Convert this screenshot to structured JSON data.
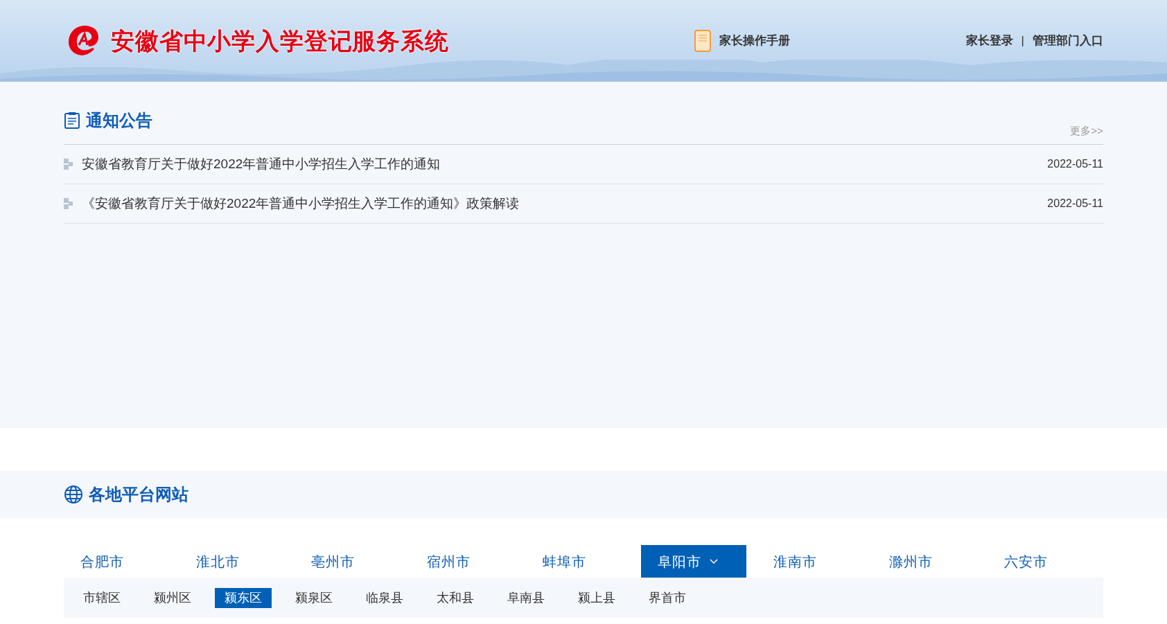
{
  "header": {
    "title": "安徽省中小学入学登记服务系统",
    "manual_link": "家长操作手册",
    "nav": [
      "家长登录",
      "管理部门入口"
    ],
    "separator": "|"
  },
  "notices": {
    "title": "通知公告",
    "more": "更多>>",
    "items": [
      {
        "title": "安徽省教育厅关于做好2022年普通中小学招生入学工作的通知",
        "date": "2022-05-11"
      },
      {
        "title": "《安徽省教育厅关于做好2022年普通中小学招生入学工作的通知》政策解读",
        "date": "2022-05-11"
      }
    ]
  },
  "regions": {
    "title": "各地平台网站",
    "cities": [
      {
        "label": "合肥市",
        "selected": false
      },
      {
        "label": "淮北市",
        "selected": false
      },
      {
        "label": "亳州市",
        "selected": false
      },
      {
        "label": "宿州市",
        "selected": false
      },
      {
        "label": "蚌埠市",
        "selected": false
      },
      {
        "label": "阜阳市",
        "selected": true
      },
      {
        "label": "淮南市",
        "selected": false
      },
      {
        "label": "滁州市",
        "selected": false
      },
      {
        "label": "六安市",
        "selected": false
      }
    ],
    "districts": [
      {
        "label": "市辖区",
        "selected": false
      },
      {
        "label": "颍州区",
        "selected": false
      },
      {
        "label": "颍东区",
        "selected": true
      },
      {
        "label": "颍泉区",
        "selected": false
      },
      {
        "label": "临泉县",
        "selected": false
      },
      {
        "label": "太和县",
        "selected": false
      },
      {
        "label": "阜南县",
        "selected": false
      },
      {
        "label": "颍上县",
        "selected": false
      },
      {
        "label": "界首市",
        "selected": false
      }
    ]
  }
}
